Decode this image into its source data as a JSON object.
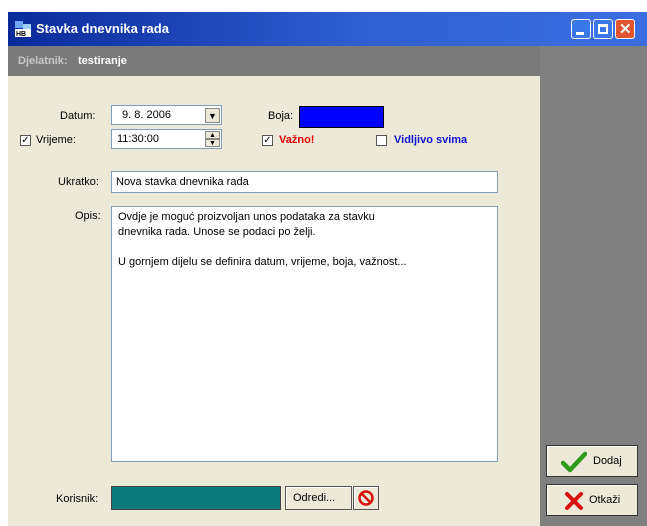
{
  "window": {
    "title": "Stavka dnevnika rada",
    "colors": {
      "titlebar": "#1f4fbf",
      "panel": "#ece9d8",
      "side": "#808080"
    }
  },
  "header": {
    "djelatnik_label": "Djelatnik:",
    "djelatnik_value": "testiranje"
  },
  "form": {
    "datum_label": "Datum:",
    "datum_value": "9. 8. 2006",
    "boja_label": "Boja:",
    "boja_color": "#0000ff",
    "vrijeme_checked": true,
    "vrijeme_label": "Vrijeme:",
    "vrijeme_value": "11:30:00",
    "vaznost_checked": true,
    "vaznost_label": "Važno!",
    "vidljivo_checked": false,
    "vidljivo_label": "Vidljivo svima",
    "ukratko_label": "Ukratko:",
    "ukratko_value": "Nova stavka dnevnika rada",
    "opis_label": "Opis:",
    "opis_lines": [
      "Ovdje je moguć proizvoljan unos podataka za stavku",
      "dnevnika rada. Unose se podaci po želji.",
      "",
      "U gornjem dijelu se definira datum, vrijeme, boja, važnost..."
    ],
    "korisnik_label": "Korisnik:",
    "korisnik_color": "#0a7a7a",
    "odredi_label": "Odredi..."
  },
  "buttons": {
    "dodaj_label": "Dodaj",
    "otkazi_label": "Otkaži"
  }
}
